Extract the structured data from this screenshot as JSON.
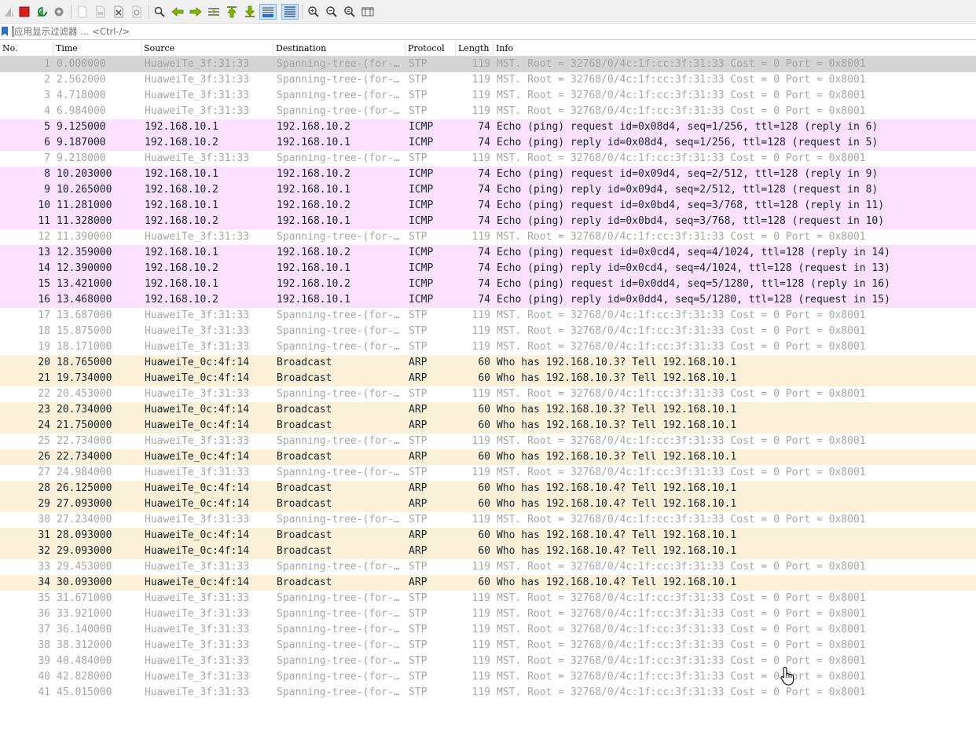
{
  "filter": {
    "placeholder": "应用显示过滤器 … <Ctrl-/>",
    "value": ""
  },
  "toolbar": {
    "buttons": [
      {
        "id": "start-capture-button",
        "icon": "shark-fin-icon",
        "enabled": false
      },
      {
        "id": "stop-capture-button",
        "icon": "stop-square-icon",
        "enabled": true
      },
      {
        "id": "restart-capture-button",
        "icon": "restart-fin-icon",
        "enabled": true
      },
      {
        "id": "capture-options-button",
        "icon": "gear-icon",
        "enabled": true
      },
      {
        "id": "open-file-button",
        "icon": "file-icon",
        "enabled": false
      },
      {
        "id": "save-file-button",
        "icon": "file-binary-icon",
        "enabled": false
      },
      {
        "id": "close-file-button",
        "icon": "file-close-icon",
        "enabled": false
      },
      {
        "id": "reload-file-button",
        "icon": "file-reload-icon",
        "enabled": false
      },
      {
        "id": "find-packet-button",
        "icon": "magnifier-icon",
        "enabled": true
      },
      {
        "id": "go-back-button",
        "icon": "arrow-left-icon",
        "enabled": true
      },
      {
        "id": "go-forward-button",
        "icon": "arrow-right-icon",
        "enabled": true
      },
      {
        "id": "go-to-packet-button",
        "icon": "goto-packet-icon",
        "enabled": true
      },
      {
        "id": "first-packet-button",
        "icon": "arrow-top-icon",
        "enabled": true
      },
      {
        "id": "last-packet-button",
        "icon": "arrow-bottom-icon",
        "enabled": true
      },
      {
        "id": "auto-scroll-button",
        "icon": "auto-scroll-icon",
        "enabled": true,
        "active": true
      },
      {
        "id": "colorize-button",
        "icon": "colorize-lines-icon",
        "enabled": true,
        "active": true
      },
      {
        "id": "zoom-in-button",
        "icon": "zoom-in-icon",
        "enabled": true
      },
      {
        "id": "zoom-out-button",
        "icon": "zoom-out-icon",
        "enabled": true
      },
      {
        "id": "normal-size-button",
        "icon": "zoom-normal-icon",
        "enabled": true
      },
      {
        "id": "resize-columns-button",
        "icon": "resize-columns-icon",
        "enabled": true
      }
    ]
  },
  "columns": [
    "No.",
    "Time",
    "Source",
    "Destination",
    "Protocol",
    "Length",
    "Info"
  ],
  "colors": {
    "stp_bg": "#ffffff",
    "stp_fg": "#a6a6a6",
    "selected_bg": "#d4d4d4",
    "icmp_bg": "#fce0ff",
    "arp_bg": "#faf0d7",
    "normal_fg": "#12272e"
  },
  "packets": [
    {
      "no": "1",
      "time": "0.000000",
      "src": "HuaweiTe_3f:31:33",
      "dst": "Spanning-tree-(for-…",
      "proto": "STP",
      "len": "119",
      "info": "MST. Root = 32768/0/4c:1f:cc:3f:31:33  Cost = 0  Port = 0x8001"
    },
    {
      "no": "2",
      "time": "2.562000",
      "src": "HuaweiTe_3f:31:33",
      "dst": "Spanning-tree-(for-…",
      "proto": "STP",
      "len": "119",
      "info": "MST. Root = 32768/0/4c:1f:cc:3f:31:33  Cost = 0  Port = 0x8001"
    },
    {
      "no": "3",
      "time": "4.718000",
      "src": "HuaweiTe_3f:31:33",
      "dst": "Spanning-tree-(for-…",
      "proto": "STP",
      "len": "119",
      "info": "MST. Root = 32768/0/4c:1f:cc:3f:31:33  Cost = 0  Port = 0x8001"
    },
    {
      "no": "4",
      "time": "6.984000",
      "src": "HuaweiTe_3f:31:33",
      "dst": "Spanning-tree-(for-…",
      "proto": "STP",
      "len": "119",
      "info": "MST. Root = 32768/0/4c:1f:cc:3f:31:33  Cost = 0  Port = 0x8001"
    },
    {
      "no": "5",
      "time": "9.125000",
      "src": "192.168.10.1",
      "dst": "192.168.10.2",
      "proto": "ICMP",
      "len": "74",
      "info": "Echo (ping) request  id=0x08d4, seq=1/256, ttl=128 (reply in 6)"
    },
    {
      "no": "6",
      "time": "9.187000",
      "src": "192.168.10.2",
      "dst": "192.168.10.1",
      "proto": "ICMP",
      "len": "74",
      "info": "Echo (ping) reply    id=0x08d4, seq=1/256, ttl=128 (request in 5)"
    },
    {
      "no": "7",
      "time": "9.218000",
      "src": "HuaweiTe_3f:31:33",
      "dst": "Spanning-tree-(for-…",
      "proto": "STP",
      "len": "119",
      "info": "MST. Root = 32768/0/4c:1f:cc:3f:31:33  Cost = 0  Port = 0x8001"
    },
    {
      "no": "8",
      "time": "10.203000",
      "src": "192.168.10.1",
      "dst": "192.168.10.2",
      "proto": "ICMP",
      "len": "74",
      "info": "Echo (ping) request  id=0x09d4, seq=2/512, ttl=128 (reply in 9)"
    },
    {
      "no": "9",
      "time": "10.265000",
      "src": "192.168.10.2",
      "dst": "192.168.10.1",
      "proto": "ICMP",
      "len": "74",
      "info": "Echo (ping) reply    id=0x09d4, seq=2/512, ttl=128 (request in 8)"
    },
    {
      "no": "10",
      "time": "11.281000",
      "src": "192.168.10.1",
      "dst": "192.168.10.2",
      "proto": "ICMP",
      "len": "74",
      "info": "Echo (ping) request  id=0x0bd4, seq=3/768, ttl=128 (reply in 11)"
    },
    {
      "no": "11",
      "time": "11.328000",
      "src": "192.168.10.2",
      "dst": "192.168.10.1",
      "proto": "ICMP",
      "len": "74",
      "info": "Echo (ping) reply    id=0x0bd4, seq=3/768, ttl=128 (request in 10)"
    },
    {
      "no": "12",
      "time": "11.390000",
      "src": "HuaweiTe_3f:31:33",
      "dst": "Spanning-tree-(for-…",
      "proto": "STP",
      "len": "119",
      "info": "MST. Root = 32768/0/4c:1f:cc:3f:31:33  Cost = 0  Port = 0x8001"
    },
    {
      "no": "13",
      "time": "12.359000",
      "src": "192.168.10.1",
      "dst": "192.168.10.2",
      "proto": "ICMP",
      "len": "74",
      "info": "Echo (ping) request  id=0x0cd4, seq=4/1024, ttl=128 (reply in 14)"
    },
    {
      "no": "14",
      "time": "12.390000",
      "src": "192.168.10.2",
      "dst": "192.168.10.1",
      "proto": "ICMP",
      "len": "74",
      "info": "Echo (ping) reply    id=0x0cd4, seq=4/1024, ttl=128 (request in 13)"
    },
    {
      "no": "15",
      "time": "13.421000",
      "src": "192.168.10.1",
      "dst": "192.168.10.2",
      "proto": "ICMP",
      "len": "74",
      "info": "Echo (ping) request  id=0x0dd4, seq=5/1280, ttl=128 (reply in 16)"
    },
    {
      "no": "16",
      "time": "13.468000",
      "src": "192.168.10.2",
      "dst": "192.168.10.1",
      "proto": "ICMP",
      "len": "74",
      "info": "Echo (ping) reply    id=0x0dd4, seq=5/1280, ttl=128 (request in 15)"
    },
    {
      "no": "17",
      "time": "13.687000",
      "src": "HuaweiTe_3f:31:33",
      "dst": "Spanning-tree-(for-…",
      "proto": "STP",
      "len": "119",
      "info": "MST. Root = 32768/0/4c:1f:cc:3f:31:33  Cost = 0  Port = 0x8001"
    },
    {
      "no": "18",
      "time": "15.875000",
      "src": "HuaweiTe_3f:31:33",
      "dst": "Spanning-tree-(for-…",
      "proto": "STP",
      "len": "119",
      "info": "MST. Root = 32768/0/4c:1f:cc:3f:31:33  Cost = 0  Port = 0x8001"
    },
    {
      "no": "19",
      "time": "18.171000",
      "src": "HuaweiTe_3f:31:33",
      "dst": "Spanning-tree-(for-…",
      "proto": "STP",
      "len": "119",
      "info": "MST. Root = 32768/0/4c:1f:cc:3f:31:33  Cost = 0  Port = 0x8001"
    },
    {
      "no": "20",
      "time": "18.765000",
      "src": "HuaweiTe_0c:4f:14",
      "dst": "Broadcast",
      "proto": "ARP",
      "len": "60",
      "info": "Who has 192.168.10.3? Tell 192.168.10.1"
    },
    {
      "no": "21",
      "time": "19.734000",
      "src": "HuaweiTe_0c:4f:14",
      "dst": "Broadcast",
      "proto": "ARP",
      "len": "60",
      "info": "Who has 192.168.10.3? Tell 192.168.10.1"
    },
    {
      "no": "22",
      "time": "20.453000",
      "src": "HuaweiTe_3f:31:33",
      "dst": "Spanning-tree-(for-…",
      "proto": "STP",
      "len": "119",
      "info": "MST. Root = 32768/0/4c:1f:cc:3f:31:33  Cost = 0  Port = 0x8001"
    },
    {
      "no": "23",
      "time": "20.734000",
      "src": "HuaweiTe_0c:4f:14",
      "dst": "Broadcast",
      "proto": "ARP",
      "len": "60",
      "info": "Who has 192.168.10.3? Tell 192.168.10.1"
    },
    {
      "no": "24",
      "time": "21.750000",
      "src": "HuaweiTe_0c:4f:14",
      "dst": "Broadcast",
      "proto": "ARP",
      "len": "60",
      "info": "Who has 192.168.10.3? Tell 192.168.10.1"
    },
    {
      "no": "25",
      "time": "22.734000",
      "src": "HuaweiTe_3f:31:33",
      "dst": "Spanning-tree-(for-…",
      "proto": "STP",
      "len": "119",
      "info": "MST. Root = 32768/0/4c:1f:cc:3f:31:33  Cost = 0  Port = 0x8001"
    },
    {
      "no": "26",
      "time": "22.734000",
      "src": "HuaweiTe_0c:4f:14",
      "dst": "Broadcast",
      "proto": "ARP",
      "len": "60",
      "info": "Who has 192.168.10.3? Tell 192.168.10.1"
    },
    {
      "no": "27",
      "time": "24.984000",
      "src": "HuaweiTe_3f:31:33",
      "dst": "Spanning-tree-(for-…",
      "proto": "STP",
      "len": "119",
      "info": "MST. Root = 32768/0/4c:1f:cc:3f:31:33  Cost = 0  Port = 0x8001"
    },
    {
      "no": "28",
      "time": "26.125000",
      "src": "HuaweiTe_0c:4f:14",
      "dst": "Broadcast",
      "proto": "ARP",
      "len": "60",
      "info": "Who has 192.168.10.4? Tell 192.168.10.1"
    },
    {
      "no": "29",
      "time": "27.093000",
      "src": "HuaweiTe_0c:4f:14",
      "dst": "Broadcast",
      "proto": "ARP",
      "len": "60",
      "info": "Who has 192.168.10.4? Tell 192.168.10.1"
    },
    {
      "no": "30",
      "time": "27.234000",
      "src": "HuaweiTe_3f:31:33",
      "dst": "Spanning-tree-(for-…",
      "proto": "STP",
      "len": "119",
      "info": "MST. Root = 32768/0/4c:1f:cc:3f:31:33  Cost = 0  Port = 0x8001"
    },
    {
      "no": "31",
      "time": "28.093000",
      "src": "HuaweiTe_0c:4f:14",
      "dst": "Broadcast",
      "proto": "ARP",
      "len": "60",
      "info": "Who has 192.168.10.4? Tell 192.168.10.1"
    },
    {
      "no": "32",
      "time": "29.093000",
      "src": "HuaweiTe_0c:4f:14",
      "dst": "Broadcast",
      "proto": "ARP",
      "len": "60",
      "info": "Who has 192.168.10.4? Tell 192.168.10.1"
    },
    {
      "no": "33",
      "time": "29.453000",
      "src": "HuaweiTe_3f:31:33",
      "dst": "Spanning-tree-(for-…",
      "proto": "STP",
      "len": "119",
      "info": "MST. Root = 32768/0/4c:1f:cc:3f:31:33  Cost = 0  Port = 0x8001"
    },
    {
      "no": "34",
      "time": "30.093000",
      "src": "HuaweiTe_0c:4f:14",
      "dst": "Broadcast",
      "proto": "ARP",
      "len": "60",
      "info": "Who has 192.168.10.4? Tell 192.168.10.1"
    },
    {
      "no": "35",
      "time": "31.671000",
      "src": "HuaweiTe_3f:31:33",
      "dst": "Spanning-tree-(for-…",
      "proto": "STP",
      "len": "119",
      "info": "MST. Root = 32768/0/4c:1f:cc:3f:31:33  Cost = 0  Port = 0x8001"
    },
    {
      "no": "36",
      "time": "33.921000",
      "src": "HuaweiTe_3f:31:33",
      "dst": "Spanning-tree-(for-…",
      "proto": "STP",
      "len": "119",
      "info": "MST. Root = 32768/0/4c:1f:cc:3f:31:33  Cost = 0  Port = 0x8001"
    },
    {
      "no": "37",
      "time": "36.140000",
      "src": "HuaweiTe_3f:31:33",
      "dst": "Spanning-tree-(for-…",
      "proto": "STP",
      "len": "119",
      "info": "MST. Root = 32768/0/4c:1f:cc:3f:31:33  Cost = 0  Port = 0x8001"
    },
    {
      "no": "38",
      "time": "38.312000",
      "src": "HuaweiTe_3f:31:33",
      "dst": "Spanning-tree-(for-…",
      "proto": "STP",
      "len": "119",
      "info": "MST. Root = 32768/0/4c:1f:cc:3f:31:33  Cost = 0  Port = 0x8001"
    },
    {
      "no": "39",
      "time": "40.484000",
      "src": "HuaweiTe_3f:31:33",
      "dst": "Spanning-tree-(for-…",
      "proto": "STP",
      "len": "119",
      "info": "MST. Root = 32768/0/4c:1f:cc:3f:31:33  Cost = 0  Port = 0x8001"
    },
    {
      "no": "40",
      "time": "42.828000",
      "src": "HuaweiTe_3f:31:33",
      "dst": "Spanning-tree-(for-…",
      "proto": "STP",
      "len": "119",
      "info": "MST. Root = 32768/0/4c:1f:cc:3f:31:33  Cost = 0  Port = 0x8001"
    },
    {
      "no": "41",
      "time": "45.015000",
      "src": "HuaweiTe_3f:31:33",
      "dst": "Spanning-tree-(for-…",
      "proto": "STP",
      "len": "119",
      "info": "MST. Root = 32768/0/4c:1f:cc:3f:31:33  Cost = 0  Port = 0x8001"
    }
  ],
  "selected_packet": "1"
}
